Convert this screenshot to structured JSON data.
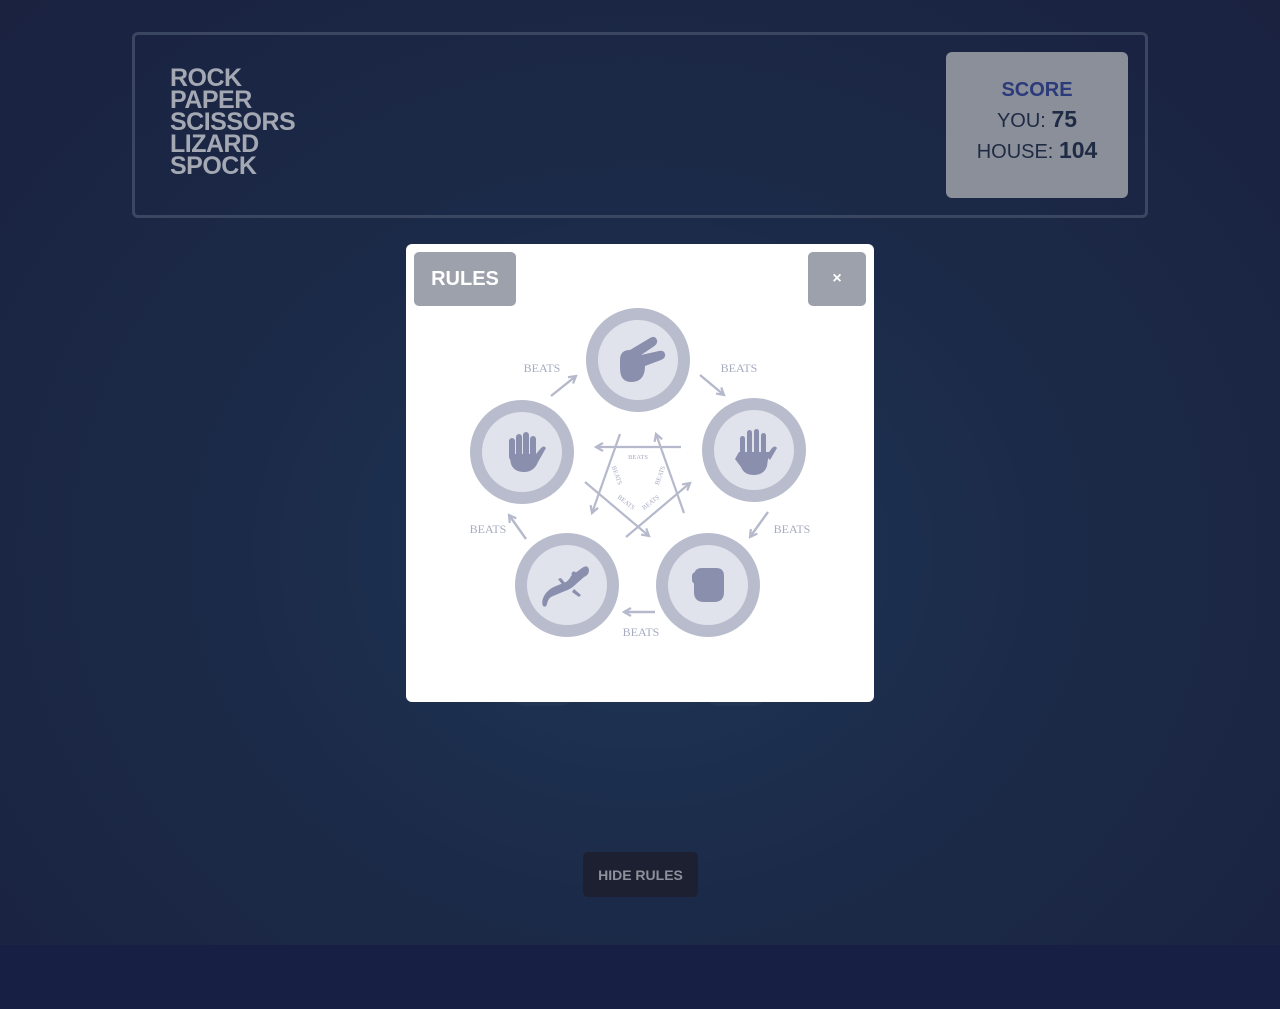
{
  "header": {
    "title_lines": [
      "ROCK",
      "PAPER",
      "SCISSORS",
      "LIZARD",
      "SPOCK"
    ]
  },
  "score": {
    "label": "SCORE",
    "you_label": "YOU:",
    "you_value": "75",
    "house_label": "HOUSE:",
    "house_value": "104"
  },
  "modal": {
    "title": "RULES",
    "close_label": "×",
    "beats_label": "BEATS",
    "choices": [
      "scissors",
      "paper",
      "rock",
      "lizard",
      "spock"
    ],
    "icon_names": [
      "scissors-hand-icon",
      "paper-hand-icon",
      "rock-fist-icon",
      "lizard-icon",
      "spock-hand-icon"
    ]
  },
  "footer": {
    "hide_rules_label": "HIDE RULES"
  },
  "colors": {
    "token_ring": "#b8bccc",
    "token_inner": "#e1e3ec",
    "icon": "#8a8fae",
    "arrow": "#b5b9cb",
    "beats_text": "#a7abc0"
  }
}
